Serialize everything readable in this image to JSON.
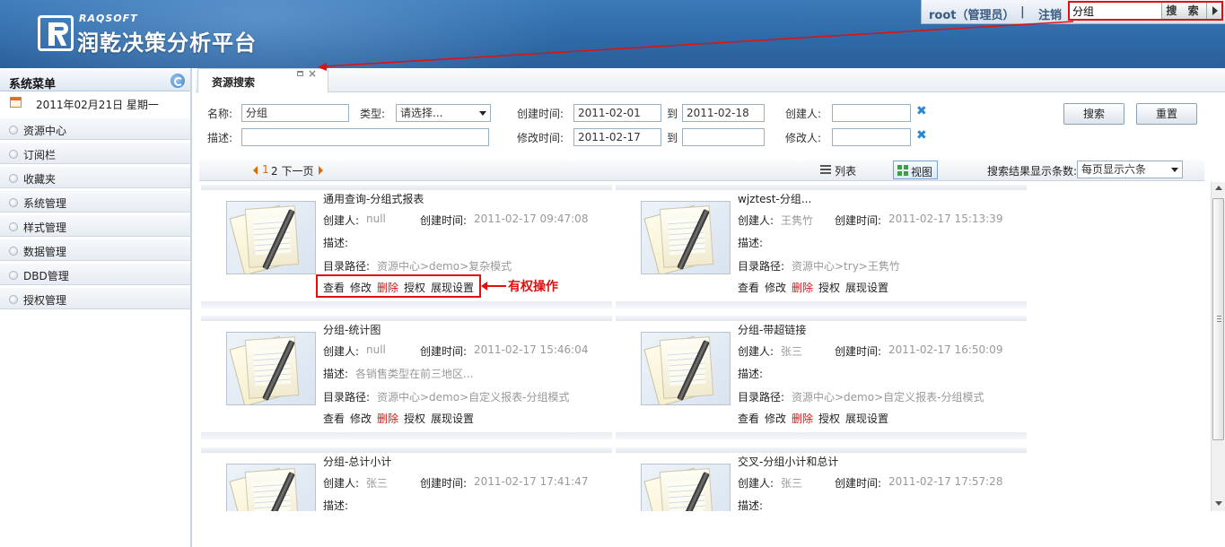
{
  "header": {
    "brand_en": "RAQSOFT",
    "brand_cn": "润乾决策分析平台",
    "user": "root（管理员）",
    "separator": "|",
    "logout": "注销",
    "search_value": "分组",
    "search_button": "搜 索"
  },
  "sidebar": {
    "title": "系统菜单",
    "date": "2011年02月21日 星期一",
    "items": [
      {
        "label": "资源中心"
      },
      {
        "label": "订阅栏"
      },
      {
        "label": "收藏夹"
      },
      {
        "label": "系统管理"
      },
      {
        "label": "样式管理"
      },
      {
        "label": "数据管理"
      },
      {
        "label": "DBD管理"
      },
      {
        "label": "授权管理"
      }
    ]
  },
  "tab": {
    "label": "资源搜索",
    "close": "×"
  },
  "form": {
    "name_label": "名称:",
    "name_value": "分组",
    "type_label": "类型:",
    "type_value": "请选择...",
    "desc_label": "描述:",
    "desc_value": "",
    "create_time_label": "创建时间:",
    "create_from": "2011-02-01",
    "to_label": "到",
    "create_to": "2011-02-18",
    "creator_label": "创建人:",
    "creator_value": "",
    "modify_time_label": "修改时间:",
    "modify_from": "2011-02-17",
    "modify_to": "",
    "modifier_label": "修改人:",
    "modifier_value": "",
    "clear_icon": "✖",
    "search_button": "搜索",
    "reset_button": "重置"
  },
  "pager": {
    "current_page": "1",
    "pages": "2 下一页",
    "list_label": "列表",
    "grid_label": "视图",
    "per_page_label": "搜索结果显示条数:",
    "per_page_value": "每页显示六条"
  },
  "labels": {
    "creator": "创建人:",
    "created": "创建时间:",
    "desc": "描述:",
    "path": "目录路径:"
  },
  "actions": [
    "查看",
    "修改",
    "删除",
    "授权",
    "展现设置"
  ],
  "annotation": "有权操作",
  "cards": [
    {
      "title": "通用查询-分组式报表",
      "creator": "null",
      "created": "2011-02-17 09:47:08",
      "desc": "",
      "path": "资源中心>demo>复杂模式"
    },
    {
      "title": "wjztest-分组...",
      "creator": "王隽竹",
      "created": "2011-02-17 15:13:39",
      "desc": "",
      "path": "资源中心>try>王隽竹"
    },
    {
      "title": "分组-统计图",
      "creator": "null",
      "created": "2011-02-17 15:46:04",
      "desc": "各销售类型在前三地区...",
      "path": "资源中心>demo>自定义报表-分组模式"
    },
    {
      "title": "分组-带超链接",
      "creator": "张三",
      "created": "2011-02-17 16:50:09",
      "desc": "",
      "path": "资源中心>demo>自定义报表-分组模式"
    },
    {
      "title": "分组-总计小计",
      "creator": "张三",
      "created": "2011-02-17 17:41:47",
      "desc": "",
      "path": ""
    },
    {
      "title": "交叉-分组小计和总计",
      "creator": "张三",
      "created": "2011-02-17 17:57:28",
      "desc": "",
      "path": ""
    }
  ]
}
